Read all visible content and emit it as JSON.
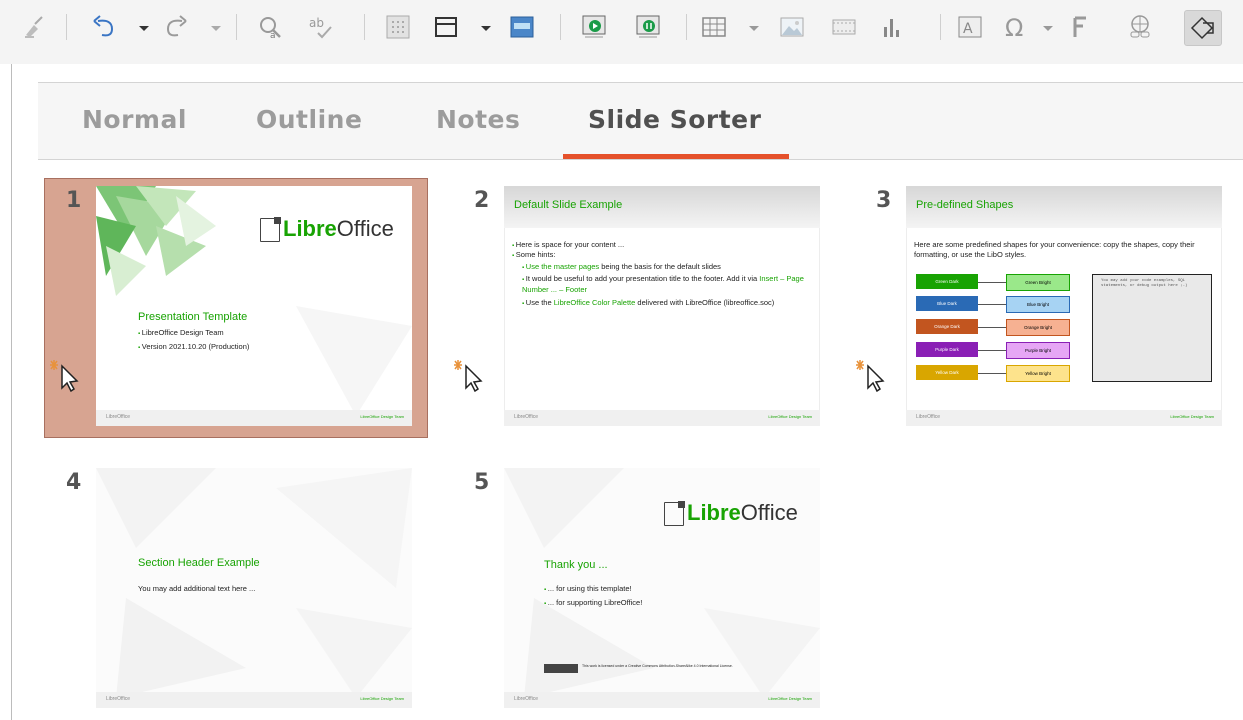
{
  "toolbar": {
    "icons": [
      "clear-formatting-icon",
      "undo-icon",
      "redo-icon",
      "find-replace-icon",
      "spelling-icon",
      "display-grid-icon",
      "master-slides-icon",
      "slide-layout-icon",
      "start-first-slide-icon",
      "start-current-slide-icon",
      "table-icon",
      "image-icon",
      "media-icon",
      "chart-icon",
      "textbox-icon",
      "special-character-icon",
      "fontwork-icon",
      "hyperlink-icon",
      "shapes-icon"
    ]
  },
  "tabs": {
    "normal": "Normal",
    "outline": "Outline",
    "notes": "Notes",
    "slide_sorter": "Slide Sorter",
    "active": "Slide Sorter"
  },
  "slides": [
    {
      "number": "1",
      "logo_a": "Libre",
      "logo_b": "Office",
      "title": "Presentation Template",
      "bullets": [
        "LibreOffice Design Team",
        "Version 2021.10.20 (Production)"
      ],
      "footer_left": "LibreOffice",
      "footer_right": "LibreOffice Design Team"
    },
    {
      "number": "2",
      "title": "Default Slide Example",
      "bullets": [
        "Here is space for your content ...",
        "Some hints:"
      ],
      "subbullets": [
        {
          "green": "Use the master pages",
          "rest": " being the basis for the default slides"
        },
        {
          "plain": "It would be useful to add your presentation title to the footer. Add it via ",
          "green": "Insert – Page Number ... – Footer"
        },
        {
          "plain": "Use the ",
          "green": "LibreOffice Color Palette",
          "rest": " delivered with LibreOffice (libreoffice.soc)"
        }
      ],
      "footer_left": "LibreOffice",
      "footer_right": "LibreOffice Design Team"
    },
    {
      "number": "3",
      "title": "Pre-defined Shapes",
      "intro": "Here are some predefined shapes for your convenience: copy the shapes, copy their formatting, or use the LibO styles.",
      "shapes": [
        {
          "dark": "Green Dark",
          "light": "Green Bright"
        },
        {
          "dark": "Blue Dark",
          "light": "Blue Bright"
        },
        {
          "dark": "Orange Dark",
          "light": "Orange Bright"
        },
        {
          "dark": "Purple Dark",
          "light": "Purple Bright"
        },
        {
          "dark": "Yellow Dark",
          "light": "Yellow Bright"
        }
      ],
      "code": "You may add your code examples, SQL statements, or debug output here ;-)",
      "footer_left": "LibreOffice",
      "footer_right": "LibreOffice Design Team"
    },
    {
      "number": "4",
      "title": "Section Header Example",
      "body": "You may add additional text here ...",
      "footer_left": "LibreOffice",
      "footer_right": "LibreOffice Design Team"
    },
    {
      "number": "5",
      "logo_a": "Libre",
      "logo_b": "Office",
      "title": "Thank you ...",
      "bullets": [
        "... for using this template!",
        "... for supporting LibreOffice!"
      ],
      "license": "This work is licensed under a Creative Commons Attribution-ShareAlike 4.0 International License.",
      "footer_left": "LibreOffice",
      "footer_right": "LibreOffice Design Team"
    }
  ],
  "selected_slide": "1",
  "colors": {
    "accent_tab": "#e5512b",
    "selection": "#d7a491",
    "libre_green": "#18a303"
  }
}
